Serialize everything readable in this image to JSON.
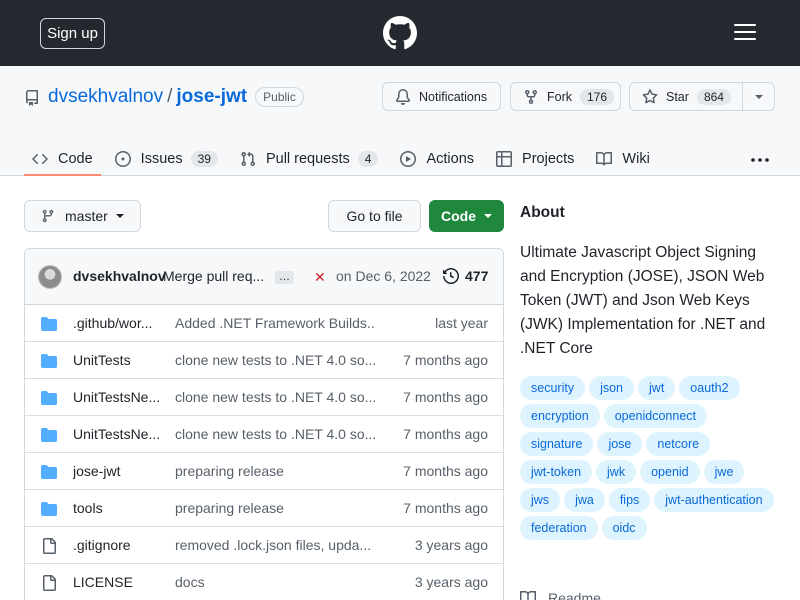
{
  "header": {
    "signup_label": "Sign up",
    "logo_icon": "github-mark-icon",
    "menu_icon": "hamburger-icon"
  },
  "repo": {
    "owner": "dvsekhvalnov",
    "separator": "/",
    "name": "jose-jwt",
    "visibility": "Public",
    "notifications_label": "Notifications",
    "fork_label": "Fork",
    "fork_count": "176",
    "star_label": "Star",
    "star_count": "864"
  },
  "tabs": [
    {
      "label": "Code",
      "icon": "code-icon",
      "count": ""
    },
    {
      "label": "Issues",
      "icon": "issue-icon",
      "count": "39"
    },
    {
      "label": "Pull requests",
      "icon": "pull-request-icon",
      "count": "4"
    },
    {
      "label": "Actions",
      "icon": "play-icon",
      "count": ""
    },
    {
      "label": "Projects",
      "icon": "table-icon",
      "count": ""
    },
    {
      "label": "Wiki",
      "icon": "book-icon",
      "count": ""
    }
  ],
  "toolbar": {
    "branch": "master",
    "go_to_file": "Go to file",
    "code_label": "Code"
  },
  "commit": {
    "author": "dvsekhvalnov",
    "message": "Merge pull req...",
    "ellipsis": "…",
    "status": "✕",
    "date": "on Dec 6, 2022",
    "history_count": "477"
  },
  "files": [
    {
      "type": "folder",
      "name": ".github/wor...",
      "message": "Added .NET Framework Builds...",
      "age": "last year"
    },
    {
      "type": "folder",
      "name": "UnitTests",
      "message": "clone new tests to .NET 4.0 so...",
      "age": "7 months ago"
    },
    {
      "type": "folder",
      "name": "UnitTestsNe...",
      "message": "clone new tests to .NET 4.0 so...",
      "age": "7 months ago"
    },
    {
      "type": "folder",
      "name": "UnitTestsNe...",
      "message": "clone new tests to .NET 4.0 so...",
      "age": "7 months ago"
    },
    {
      "type": "folder",
      "name": "jose-jwt",
      "message": "preparing release",
      "age": "7 months ago"
    },
    {
      "type": "folder",
      "name": "tools",
      "message": "preparing release",
      "age": "7 months ago"
    },
    {
      "type": "file",
      "name": ".gitignore",
      "message": "removed .lock.json files, upda...",
      "age": "3 years ago"
    },
    {
      "type": "file",
      "name": "LICENSE",
      "message": "docs",
      "age": "3 years ago"
    }
  ],
  "about": {
    "heading": "About",
    "description": "Ultimate Javascript Object Signing and Encryption (JOSE), JSON Web Token (JWT) and Json Web Keys (JWK) Implementation for .NET and .NET Core",
    "topics": [
      "security",
      "json",
      "jwt",
      "oauth2",
      "encryption",
      "openidconnect",
      "signature",
      "jose",
      "netcore",
      "jwt-token",
      "jwk",
      "openid",
      "jwe",
      "jws",
      "jwa",
      "fips",
      "jwt-authentication",
      "federation",
      "oidc"
    ],
    "readme_label": "Readme"
  },
  "colors": {
    "header_bg": "#24292f",
    "accent_link": "#0969da",
    "primary_button": "#1f883d",
    "active_tab_underline": "#fd8c73",
    "folder_icon": "#54aeff",
    "topic_bg": "#ddf4ff",
    "error": "#cf222e"
  }
}
